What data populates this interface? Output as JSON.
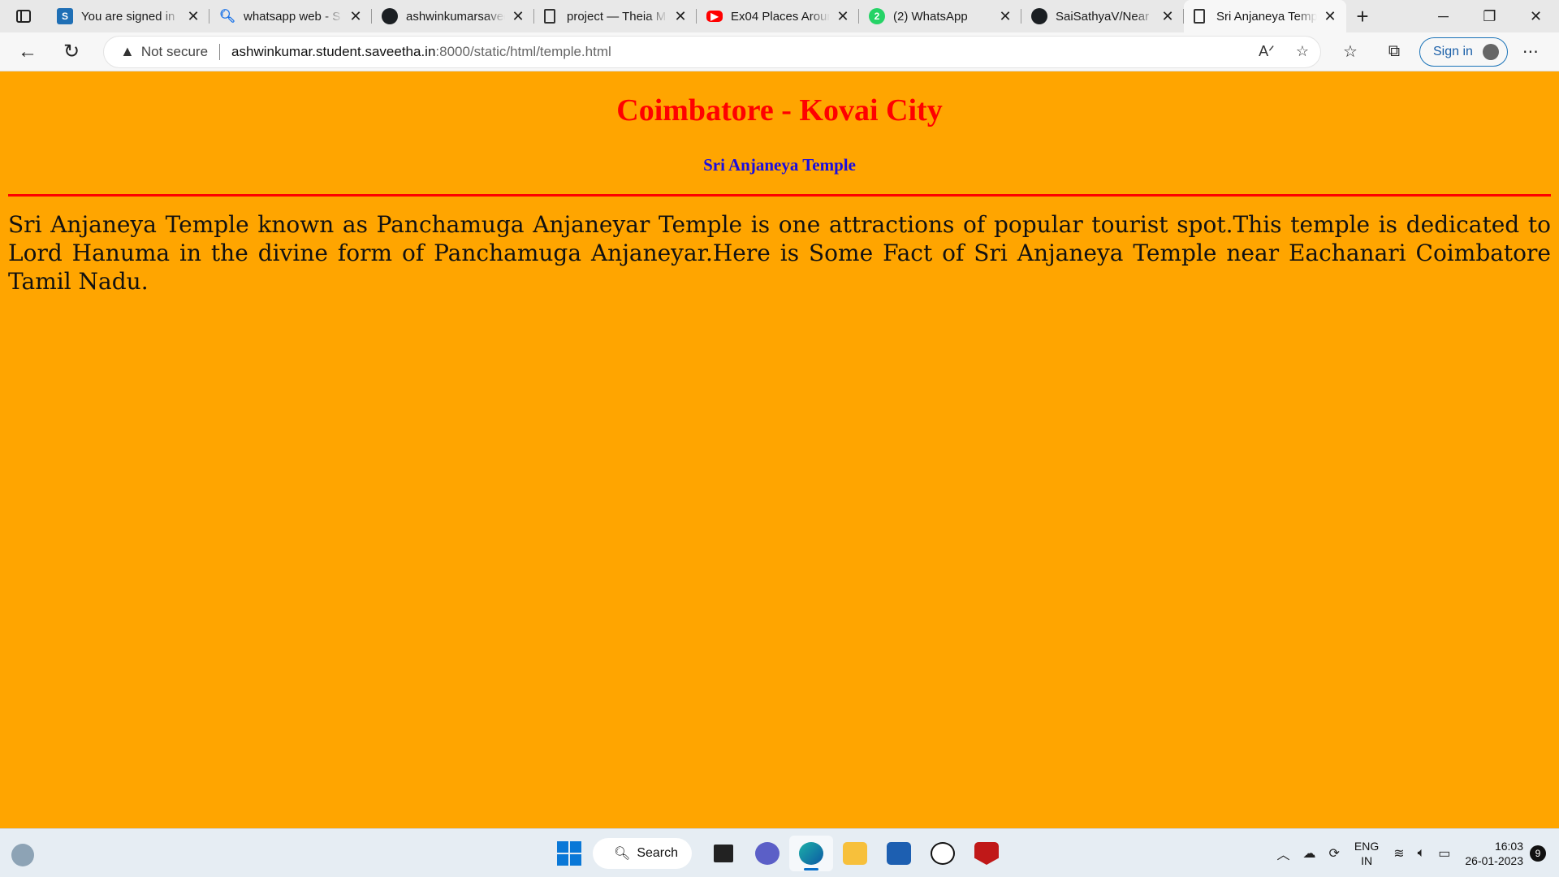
{
  "browser": {
    "tabs": [
      {
        "icon": "S",
        "icon_kind": "s",
        "title": "You are signed in"
      },
      {
        "icon": "search-icon",
        "icon_kind": "search",
        "title": "whatsapp web - S"
      },
      {
        "icon": "github-icon",
        "icon_kind": "gh",
        "title": "ashwinkumarsaved"
      },
      {
        "icon": "document-icon",
        "icon_kind": "doc",
        "title": "project — Theia M"
      },
      {
        "icon": "youtube-icon",
        "icon_kind": "yt",
        "title": "Ex04 Places Aroun"
      },
      {
        "icon": "2",
        "icon_kind": "wa",
        "title": "(2) WhatsApp"
      },
      {
        "icon": "github-icon",
        "icon_kind": "gh",
        "title": "SaiSathyaV/Near"
      },
      {
        "icon": "document-icon",
        "icon_kind": "doc",
        "title": "Sri Anjaneya Temp",
        "active": true
      }
    ],
    "address": {
      "security_label": "Not secure",
      "url_host": "ashwinkumar.student.saveetha.in",
      "url_path": ":8000/static/html/temple.html"
    },
    "signin_label": "Sign in"
  },
  "page": {
    "heading": "Coimbatore - Kovai City",
    "subheading": "Sri Anjaneya Temple",
    "paragraph": "Sri Anjaneya Temple known as Panchamuga Anjaneyar Temple is one attractions of popular tourist spot.This temple is dedicated to Lord Hanuma in the divine form of Panchamuga Anjaneyar.Here is Some Fact of Sri Anjaneya Temple near Eachanari Coimbatore Tamil Nadu.",
    "background_color": "#ffa500",
    "heading_color": "#ff0000",
    "subheading_color": "#1a0de0"
  },
  "taskbar": {
    "search_label": "Search",
    "lang_line1": "ENG",
    "lang_line2": "IN",
    "time": "16:03",
    "date": "26-01-2023",
    "notification_count": "9"
  }
}
